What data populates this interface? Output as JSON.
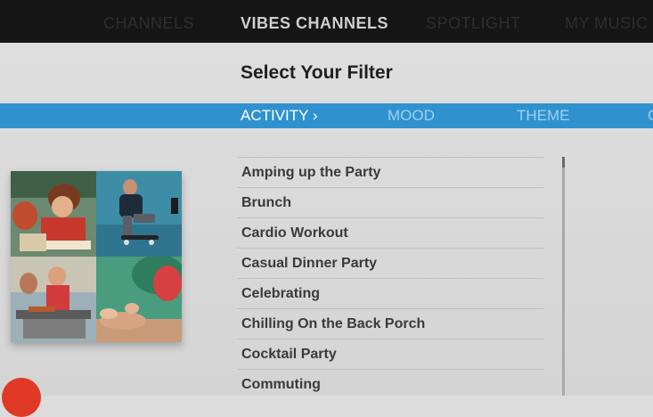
{
  "top_nav": {
    "items": [
      {
        "label": "CHANNELS"
      },
      {
        "label": "VIBES CHANNELS"
      },
      {
        "label": "SPOTLIGHT"
      },
      {
        "label": "MY MUSIC"
      }
    ],
    "active_index": 1
  },
  "page": {
    "title": "Select Your Filter"
  },
  "filter_tabs": [
    {
      "label": "ACTIVITY ›"
    },
    {
      "label": "MOOD"
    },
    {
      "label": "THEME"
    },
    {
      "label": "C"
    }
  ],
  "filter_list": [
    "Amping up the Party",
    "Brunch",
    "Cardio Workout",
    "Casual Dinner Party",
    "Celebrating",
    "Chilling On the Back Porch",
    "Cocktail Party",
    "Commuting"
  ],
  "colors": {
    "accent_blue": "#2f92cf",
    "badge_red": "#e03a26"
  }
}
